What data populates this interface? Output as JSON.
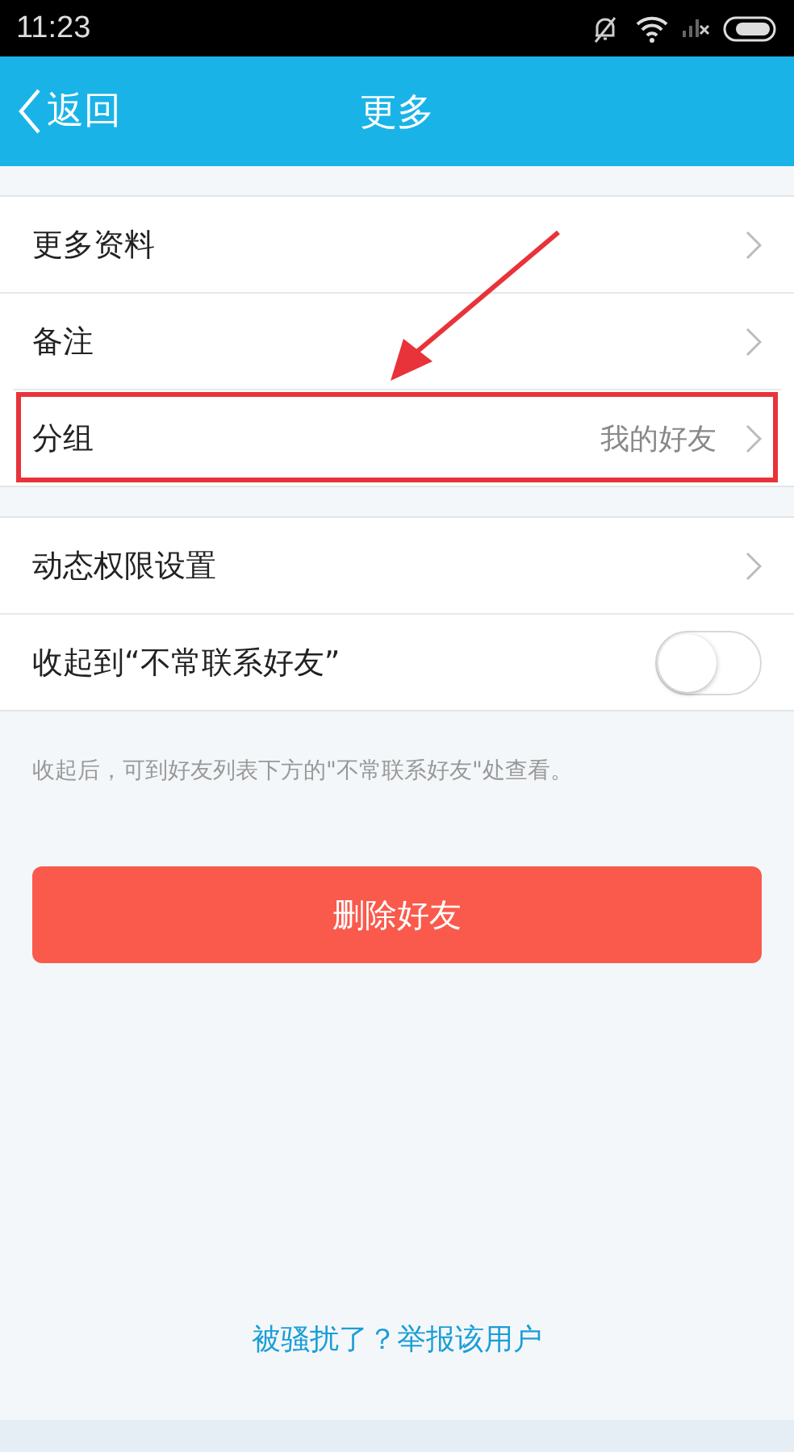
{
  "status_bar": {
    "time": "11:23"
  },
  "nav": {
    "back": "返回",
    "title": "更多"
  },
  "sections": [
    {
      "items": [
        {
          "kind": "link",
          "label": "更多资料",
          "annotated": false
        },
        {
          "kind": "link",
          "label": "备注",
          "annotated": false
        },
        {
          "kind": "link",
          "label": "分组",
          "value": "我的好友",
          "annotated": true
        }
      ]
    },
    {
      "items": [
        {
          "kind": "link",
          "label": "动态权限设置",
          "annotated": false
        },
        {
          "kind": "toggle",
          "label": "收起到“不常联系好友”",
          "on": false,
          "annotated": false
        }
      ]
    }
  ],
  "hint": "收起后，可到好友列表下方的\"不常联系好友\"处查看。",
  "delete_button": "删除好友",
  "report_link": "被骚扰了？举报该用户"
}
